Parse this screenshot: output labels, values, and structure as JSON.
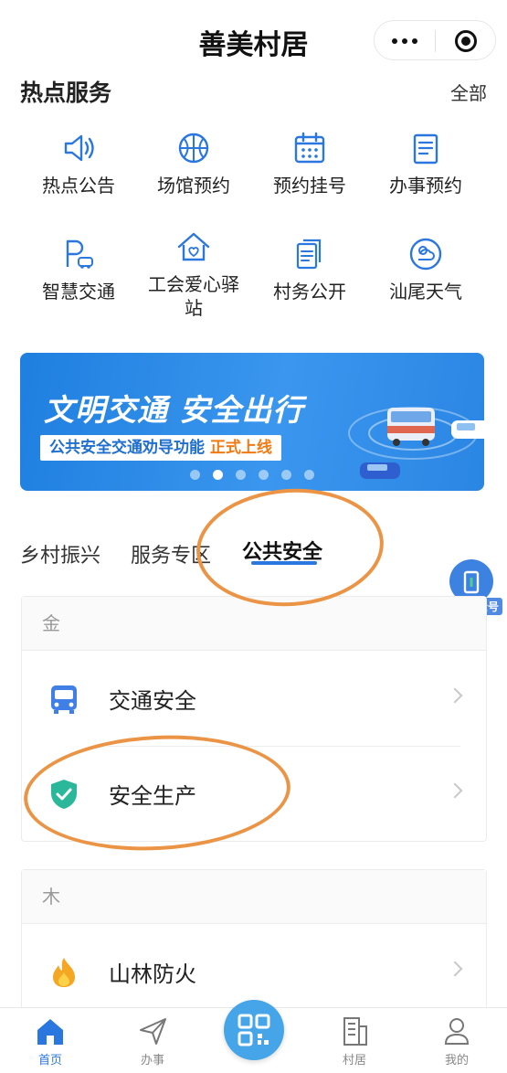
{
  "header": {
    "title": "善美村居"
  },
  "hot_services": {
    "title": "热点服务",
    "all_link": "全部",
    "items": [
      {
        "label": "热点公告",
        "icon": "speaker-icon"
      },
      {
        "label": "场馆预约",
        "icon": "basketball-icon"
      },
      {
        "label": "预约挂号",
        "icon": "calendar-icon"
      },
      {
        "label": "办事预约",
        "icon": "notepad-icon"
      },
      {
        "label": "智慧交通",
        "icon": "parking-car-icon"
      },
      {
        "label": "工会爱心驿站",
        "icon": "house-heart-icon"
      },
      {
        "label": "村务公开",
        "icon": "document-icon"
      },
      {
        "label": "汕尾天气",
        "icon": "weather-icon"
      }
    ]
  },
  "banner": {
    "headline": "文明交通  安全出行",
    "subline_prefix": "公共安全交通劝导功能 ",
    "subline_highlight": "正式上线",
    "slide_count": 6,
    "active_slide": 1
  },
  "tabs": [
    {
      "label": "乡村振兴",
      "active": false
    },
    {
      "label": "服务专区",
      "active": false
    },
    {
      "label": "公共安全",
      "active": true
    }
  ],
  "follow_badge": {
    "label": "关注公众号"
  },
  "cards": [
    {
      "header": "金",
      "rows": [
        {
          "label": "交通安全",
          "icon": "bus-icon"
        },
        {
          "label": "安全生产",
          "icon": "shield-check-icon"
        }
      ]
    },
    {
      "header": "木",
      "rows": [
        {
          "label": "山林防火",
          "icon": "fire-icon"
        }
      ]
    }
  ],
  "bottom_nav": {
    "items": [
      {
        "label": "首页",
        "icon": "home-icon",
        "active": true
      },
      {
        "label": "办事",
        "icon": "send-icon",
        "active": false
      },
      {
        "label": "村居",
        "icon": "building-icon",
        "active": false
      },
      {
        "label": "我的",
        "icon": "user-icon",
        "active": false
      }
    ],
    "center": {
      "icon": "qr-scan-icon"
    }
  },
  "colors": {
    "accent": "#2b77e0",
    "banner": "#2a86e3",
    "annotation": "#ec9446",
    "shield": "#2bb89a",
    "fire": "#f5a623"
  }
}
